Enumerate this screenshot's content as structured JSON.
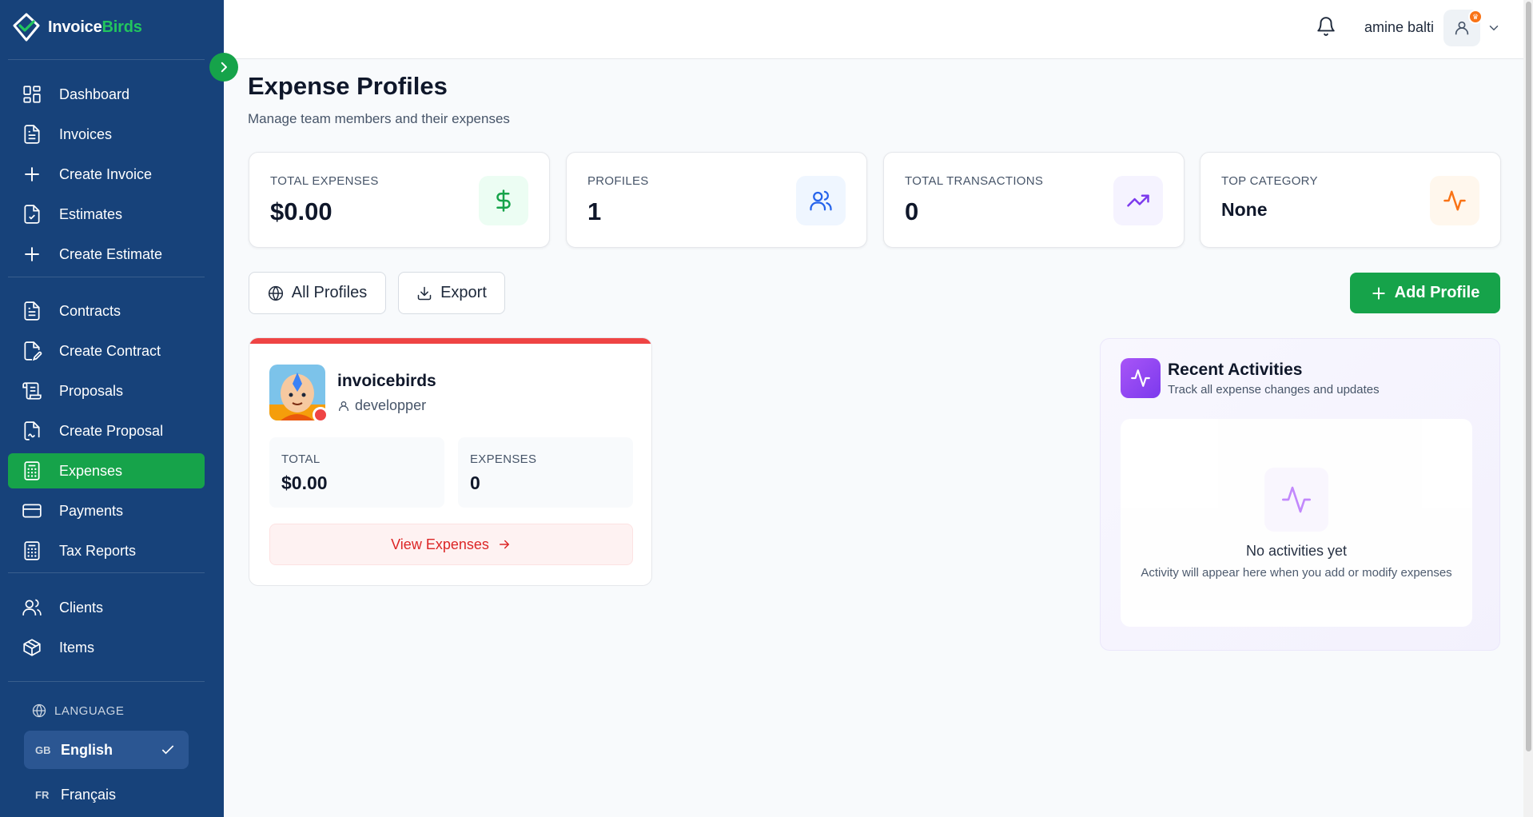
{
  "app": {
    "brand_main": "Invoice",
    "brand_accent": "Birds",
    "accent_color": "#16a34a",
    "sidebar_color": "#17427a"
  },
  "sidebar": {
    "items": [
      {
        "label": "Dashboard",
        "icon": "dashboard-icon"
      },
      {
        "label": "Invoices",
        "icon": "document-icon"
      },
      {
        "label": "Create Invoice",
        "icon": "plus-icon"
      },
      {
        "label": "Estimates",
        "icon": "document-check-icon"
      },
      {
        "label": "Create Estimate",
        "icon": "plus-icon"
      },
      {
        "label": "Contracts",
        "icon": "document-icon"
      },
      {
        "label": "Create Contract",
        "icon": "document-edit-icon"
      },
      {
        "label": "Proposals",
        "icon": "scroll-icon"
      },
      {
        "label": "Create Proposal",
        "icon": "file-signature-icon"
      },
      {
        "label": "Expenses",
        "icon": "calculator-icon",
        "active": true
      },
      {
        "label": "Payments",
        "icon": "credit-card-icon"
      },
      {
        "label": "Tax Reports",
        "icon": "calculator-icon"
      },
      {
        "label": "Clients",
        "icon": "users-icon"
      },
      {
        "label": "Items",
        "icon": "package-icon"
      }
    ],
    "language": {
      "heading": "LANGUAGE",
      "options": [
        {
          "code": "GB",
          "label": "English",
          "selected": true
        },
        {
          "code": "FR",
          "label": "Français",
          "selected": false
        }
      ]
    }
  },
  "header": {
    "user_name": "amine balti"
  },
  "page": {
    "title": "Expense Profiles",
    "subtitle": "Manage team members and their expenses"
  },
  "stats": [
    {
      "label": "TOTAL EXPENSES",
      "value": "$0.00",
      "icon": "dollar-icon",
      "color": "#16a34a"
    },
    {
      "label": "PROFILES",
      "value": "1",
      "icon": "users-icon",
      "color": "#2563eb"
    },
    {
      "label": "TOTAL TRANSACTIONS",
      "value": "0",
      "icon": "trending-up-icon",
      "color": "#7c3aed"
    },
    {
      "label": "TOP CATEGORY",
      "value": "None",
      "icon": "activity-icon",
      "color": "#f97316"
    }
  ],
  "toolbar": {
    "all_profiles": "All Profiles",
    "export": "Export",
    "add_profile": "Add Profile"
  },
  "profile": {
    "name": "invoicebirds",
    "role": "developper",
    "total_label": "TOTAL",
    "total_value": "$0.00",
    "expenses_label": "EXPENSES",
    "expenses_value": "0",
    "view_button": "View Expenses"
  },
  "activities": {
    "title": "Recent Activities",
    "subtitle": "Track all expense changes and updates",
    "empty_title": "No activities yet",
    "empty_subtitle": "Activity will appear here when you add or modify expenses"
  }
}
